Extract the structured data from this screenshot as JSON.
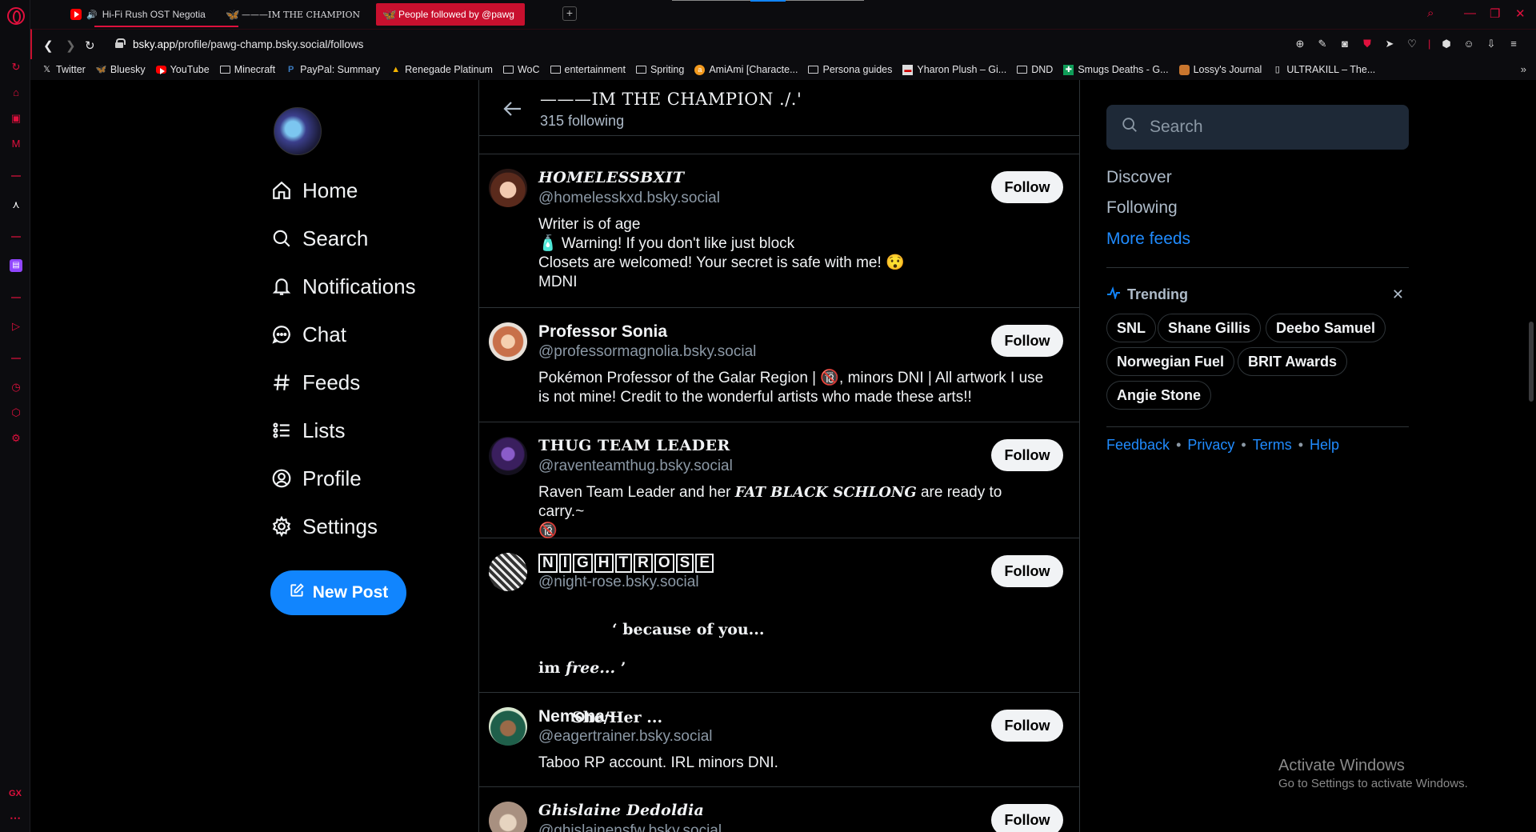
{
  "browser": {
    "tabs": [
      {
        "label": "Hi-Fi Rush OST Negotia",
        "favicon": "youtube-icon"
      },
      {
        "label": "———IM THE CHAMPION ./.",
        "favicon": "bluesky-icon"
      },
      {
        "label": "People followed by @pawg",
        "favicon": "bluesky-icon",
        "active": true
      }
    ],
    "url_host": "bsky.app",
    "url_path": "/profile/pawg-champ.bsky.social/follows",
    "bookmarks": [
      {
        "label": "Twitter",
        "icon": "x-icon"
      },
      {
        "label": "Bluesky",
        "icon": "bluesky-icon"
      },
      {
        "label": "YouTube",
        "icon": "youtube-icon"
      },
      {
        "label": "Minecraft",
        "icon": "folder-icon"
      },
      {
        "label": "PayPal: Summary",
        "icon": "paypal-icon"
      },
      {
        "label": "Renegade Platinum",
        "icon": "drive-icon"
      },
      {
        "label": "WoC",
        "icon": "folder-icon"
      },
      {
        "label": "entertainment",
        "icon": "folder-icon"
      },
      {
        "label": "Spriting",
        "icon": "folder-icon"
      },
      {
        "label": "AmiAmi [Characte...",
        "icon": "amiami-icon"
      },
      {
        "label": "Persona guides",
        "icon": "folder-icon"
      },
      {
        "label": "Yharon Plush – Gi...",
        "icon": "page-icon"
      },
      {
        "label": "DND",
        "icon": "folder-icon"
      },
      {
        "label": "Smugs Deaths - G...",
        "icon": "sheets-icon"
      },
      {
        "label": "Lossy's Journal",
        "icon": "journal-icon"
      },
      {
        "label": "ULTRAKILL – The...",
        "icon": "page-icon"
      }
    ],
    "bottom_label": "GX",
    "accent": "#e0103d"
  },
  "nav": {
    "items": [
      "Home",
      "Search",
      "Notifications",
      "Chat",
      "Feeds",
      "Lists",
      "Profile",
      "Settings"
    ],
    "new_post": "New Post"
  },
  "header": {
    "name": "———IM THE CHAMPION ./.'",
    "count": "315 following"
  },
  "follows": [
    {
      "name": "HOMELESSBXIT",
      "handle": "@homelesskxd.bsky.social",
      "bio": "Writer is of age\n🧴 Warning! If you don't like just block\nClosets are welcomed! Your secret is safe with me! 😯\nMDNI",
      "button": "Follow"
    },
    {
      "name": "Professor Sonia",
      "handle": "@professormagnolia.bsky.social",
      "bio": "Pokémon Professor of the Galar Region | 🔞, minors DNI | All artwork I use is not mine! Credit to the wonderful artists who made these arts!!",
      "button": "Follow"
    },
    {
      "name": "THUG TEAM LEADER",
      "handle": "@raventeamthug.bsky.social",
      "bio_pre": "Raven Team Leader and her ",
      "bio_styled": "FAT BLACK SCHLONG",
      "bio_post": " are ready to carry.~\n🔞",
      "button": "Follow"
    },
    {
      "name_letters": [
        "N",
        "I",
        "G",
        "H",
        "T",
        "R",
        "O",
        "S",
        "E"
      ],
      "handle": "@night-rose.bsky.social",
      "bio_line1": "‘  because of you...",
      "bio_line2_a": "im ",
      "bio_line2_b": "free...",
      "bio_line2_c": "  ’",
      "bio_line3": "She/Her ...",
      "button": "Follow"
    },
    {
      "name": "Nemona~",
      "handle": "@eagertrainer.bsky.social",
      "bio": "Taboo RP account. IRL minors DNI.",
      "button": "Follow"
    },
    {
      "name": "Ghislaine Dedoldia",
      "handle": "@ghislainensfw.bsky.social",
      "button": "Follow"
    }
  ],
  "right": {
    "search_placeholder": "Search",
    "feeds": [
      "Discover",
      "Following",
      "More feeds"
    ],
    "trending_title": "Trending",
    "trending": [
      "SNL",
      "Shane Gillis",
      "Deebo Samuel",
      "Norwegian Fuel",
      "BRIT Awards",
      "Angie Stone"
    ],
    "footer": [
      "Feedback",
      "Privacy",
      "Terms",
      "Help"
    ]
  },
  "watermark": {
    "line1": "Activate Windows",
    "line2": "Go to Settings to activate Windows."
  }
}
